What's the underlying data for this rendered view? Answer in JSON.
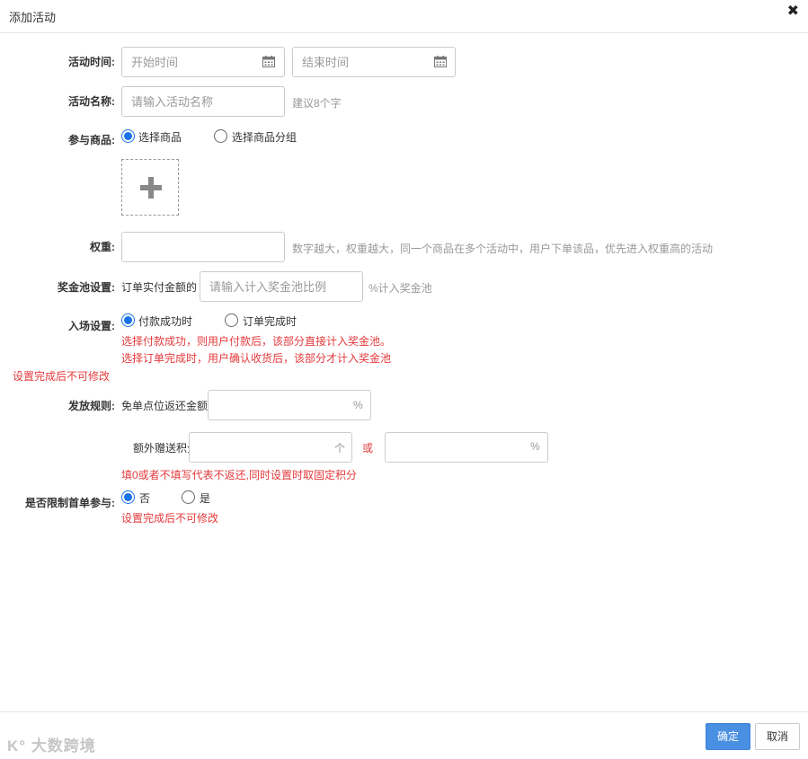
{
  "dialog": {
    "title": "添加活动",
    "close_symbol": "✖"
  },
  "form": {
    "activity_time": {
      "label": "活动时间:",
      "start_placeholder": "开始时间",
      "end_placeholder": "结束时间"
    },
    "activity_name": {
      "label": "活动名称:",
      "placeholder": "请输入活动名称",
      "hint": "建议8个字"
    },
    "products": {
      "label": "参与商品:",
      "options": [
        "选择商品",
        "选择商品分组"
      ],
      "selected": "选择商品"
    },
    "weight": {
      "label": "权重:",
      "value": "",
      "hint": "数字越大，权重越大，同一个商品在多个活动中，用户下单该品，优先进入权重高的活动"
    },
    "prize_pool": {
      "label": "奖金池设置:",
      "prefix": "订单实付金额的",
      "placeholder": "请输入计入奖金池比例",
      "suffix": "%计入奖金池"
    },
    "entry": {
      "label": "入场设置:",
      "options": [
        "付款成功时",
        "订单完成时"
      ],
      "selected": "付款成功时",
      "note1": "选择付款成功，则用户付款后，该部分直接计入奖金池。",
      "note2": "选择订单完成时，用户确认收货后，该部分才计入奖金池",
      "locked_note": "设置完成后不可修改"
    },
    "payout": {
      "label": "发放规则:",
      "rebate_label": "免单点位返还金额",
      "rebate_value": "",
      "rebate_suffix": "%",
      "points_label": "额外赠送积分",
      "points_value": "",
      "points_suffix": "个",
      "or_text": "或",
      "percent_value": "",
      "percent_suffix": "%",
      "note": "填0或者不填写代表不返还,同时设置时取固定积分"
    },
    "first_order": {
      "label": "是否限制首单参与:",
      "options": [
        "否",
        "是"
      ],
      "selected": "否",
      "note": "设置完成后不可修改"
    }
  },
  "footer": {
    "confirm_label": "确定",
    "cancel_label": "取消"
  },
  "watermark": {
    "text": "大数跨境",
    "logo_text": "K°"
  },
  "colors": {
    "primary": "#4a90e2",
    "radio_active": "#1a73e8",
    "warning": "#e4393c",
    "hint": "#999999"
  }
}
